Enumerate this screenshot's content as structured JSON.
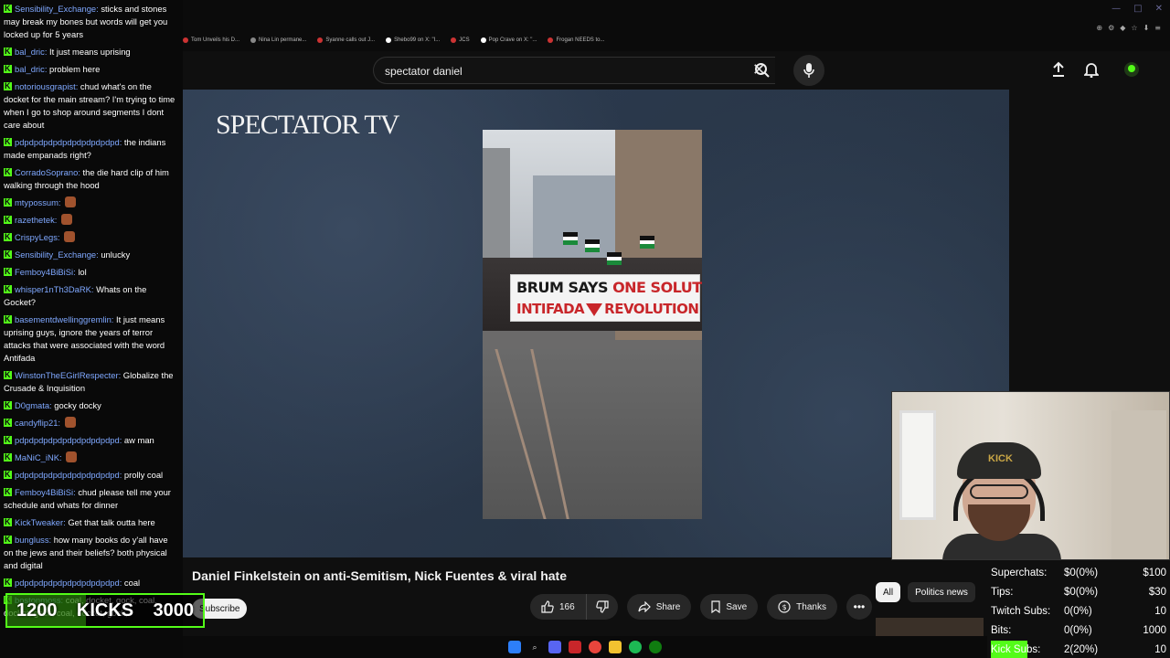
{
  "browser": {
    "bookmarks": [
      {
        "label": "Tom Unveils his D...",
        "color": "#cc3333"
      },
      {
        "label": "Nina Lin permane...",
        "color": "#888888"
      },
      {
        "label": "Syanne calls out J...",
        "color": "#cc3333"
      },
      {
        "label": "Shebo99 on X: \"I...",
        "color": "#ffffff"
      },
      {
        "label": "JCS",
        "color": "#cc3333"
      },
      {
        "label": "Pop Crave on X: \"...",
        "color": "#ffffff"
      },
      {
        "label": "Frogan NEEDS to...",
        "color": "#cc3333"
      }
    ]
  },
  "youtube": {
    "search_query": "spectator daniel",
    "video_title": "Daniel Finkelstein on anti-Semitism, Nick Fuentes & viral hate",
    "subscribe_label": "Subscribe",
    "likes": "166",
    "share_label": "Share",
    "save_label": "Save",
    "thanks_label": "Thanks",
    "chips": [
      "All",
      "Politics news"
    ]
  },
  "video": {
    "logo_text": "SPECTATOR TV",
    "banner_line1_a": "BRUM SAYS ",
    "banner_line1_b": "ONE SOLUTION",
    "banner_line2_a": "INTIFADA",
    "banner_line2_b": "REVOLUTION"
  },
  "chat": [
    {
      "user": "Sensibility_Exchange:",
      "text": "sticks and stones may break my bones but words will get you locked up for 5 years"
    },
    {
      "user": "bal_dric:",
      "text": "It just means uprising"
    },
    {
      "user": "bal_dric:",
      "text": "problem here"
    },
    {
      "user": "notoriousgrapist:",
      "text": "chud what's on the docket for the main stream? I'm trying to time when I go to shop around segments I dont care about"
    },
    {
      "user": "pdpdpdpdpdpdpdpdpdpdpd:",
      "text": "the indians made empanads right?"
    },
    {
      "user": "CorradoSoprano:",
      "text": "the die hard clip of him walking through the hood"
    },
    {
      "user": "mtypossum:",
      "text": "",
      "emote": true
    },
    {
      "user": "razethetek:",
      "text": "",
      "emote": true
    },
    {
      "user": "CrispyLegs:",
      "text": "",
      "emote": true
    },
    {
      "user": "Sensibility_Exchange:",
      "text": "unlucky"
    },
    {
      "user": "Femboy4BiBiSi:",
      "text": "lol"
    },
    {
      "user": "whisper1nTh3DaRK:",
      "text": "Whats on the Gocket?"
    },
    {
      "user": "basementdwellinggremlin:",
      "text": "It just means uprising guys, ignore the years of terror attacks that were associated with the word Antifada"
    },
    {
      "user": "WinstonTheEGirlRespecter:",
      "text": "Globalize the Crusade & Inquisition"
    },
    {
      "user": "D0gmata:",
      "text": "gocky docky"
    },
    {
      "user": "candyflip21:",
      "text": "",
      "emote": true
    },
    {
      "user": "pdpdpdpdpdpdpdpdpdpdpd:",
      "text": "aw man"
    },
    {
      "user": "MaNiC_iNK:",
      "text": "",
      "emote": true
    },
    {
      "user": "pdpdpdpdpdpdpdpdpdpdpd:",
      "text": "prolly coal"
    },
    {
      "user": "Femboy4BiBiSi:",
      "text": "chud please tell me your schedule and whats for dinner"
    },
    {
      "user": "KickTweaker:",
      "text": "Get that talk outta here"
    },
    {
      "user": "bungluss:",
      "text": "how many books do y'all have on the jews and their beliefs? both physical and digital"
    },
    {
      "user": "pdpdpdpdpdpdpdpdpdpdpd:",
      "text": "coal"
    },
    {
      "user": "bostonmoss:",
      "text": "coal, docket, gock, coal, docket, gock, coal, docket, gock,"
    }
  ],
  "kicks_goal": {
    "current": "1200",
    "label": "KICKS",
    "target": "3000",
    "progress": 0.4
  },
  "stats": [
    {
      "label": "Superchats:",
      "value": "$0(0%)",
      "goal": "$100"
    },
    {
      "label": "Tips:",
      "value": "$0(0%)",
      "goal": "$30"
    },
    {
      "label": "Twitch Subs:",
      "value": "0(0%)",
      "goal": "10"
    },
    {
      "label": "Bits:",
      "value": "0(0%)",
      "goal": "1000"
    },
    {
      "label": "Kick Subs:",
      "value": "2(20%)",
      "goal": "10",
      "progress": 0.2
    }
  ],
  "webcam": {
    "cap_text": "KICK"
  },
  "colors": {
    "kick_green": "#53fc18",
    "chat_user": "#7fa8ff",
    "yt_bg": "#0f0f0f"
  }
}
